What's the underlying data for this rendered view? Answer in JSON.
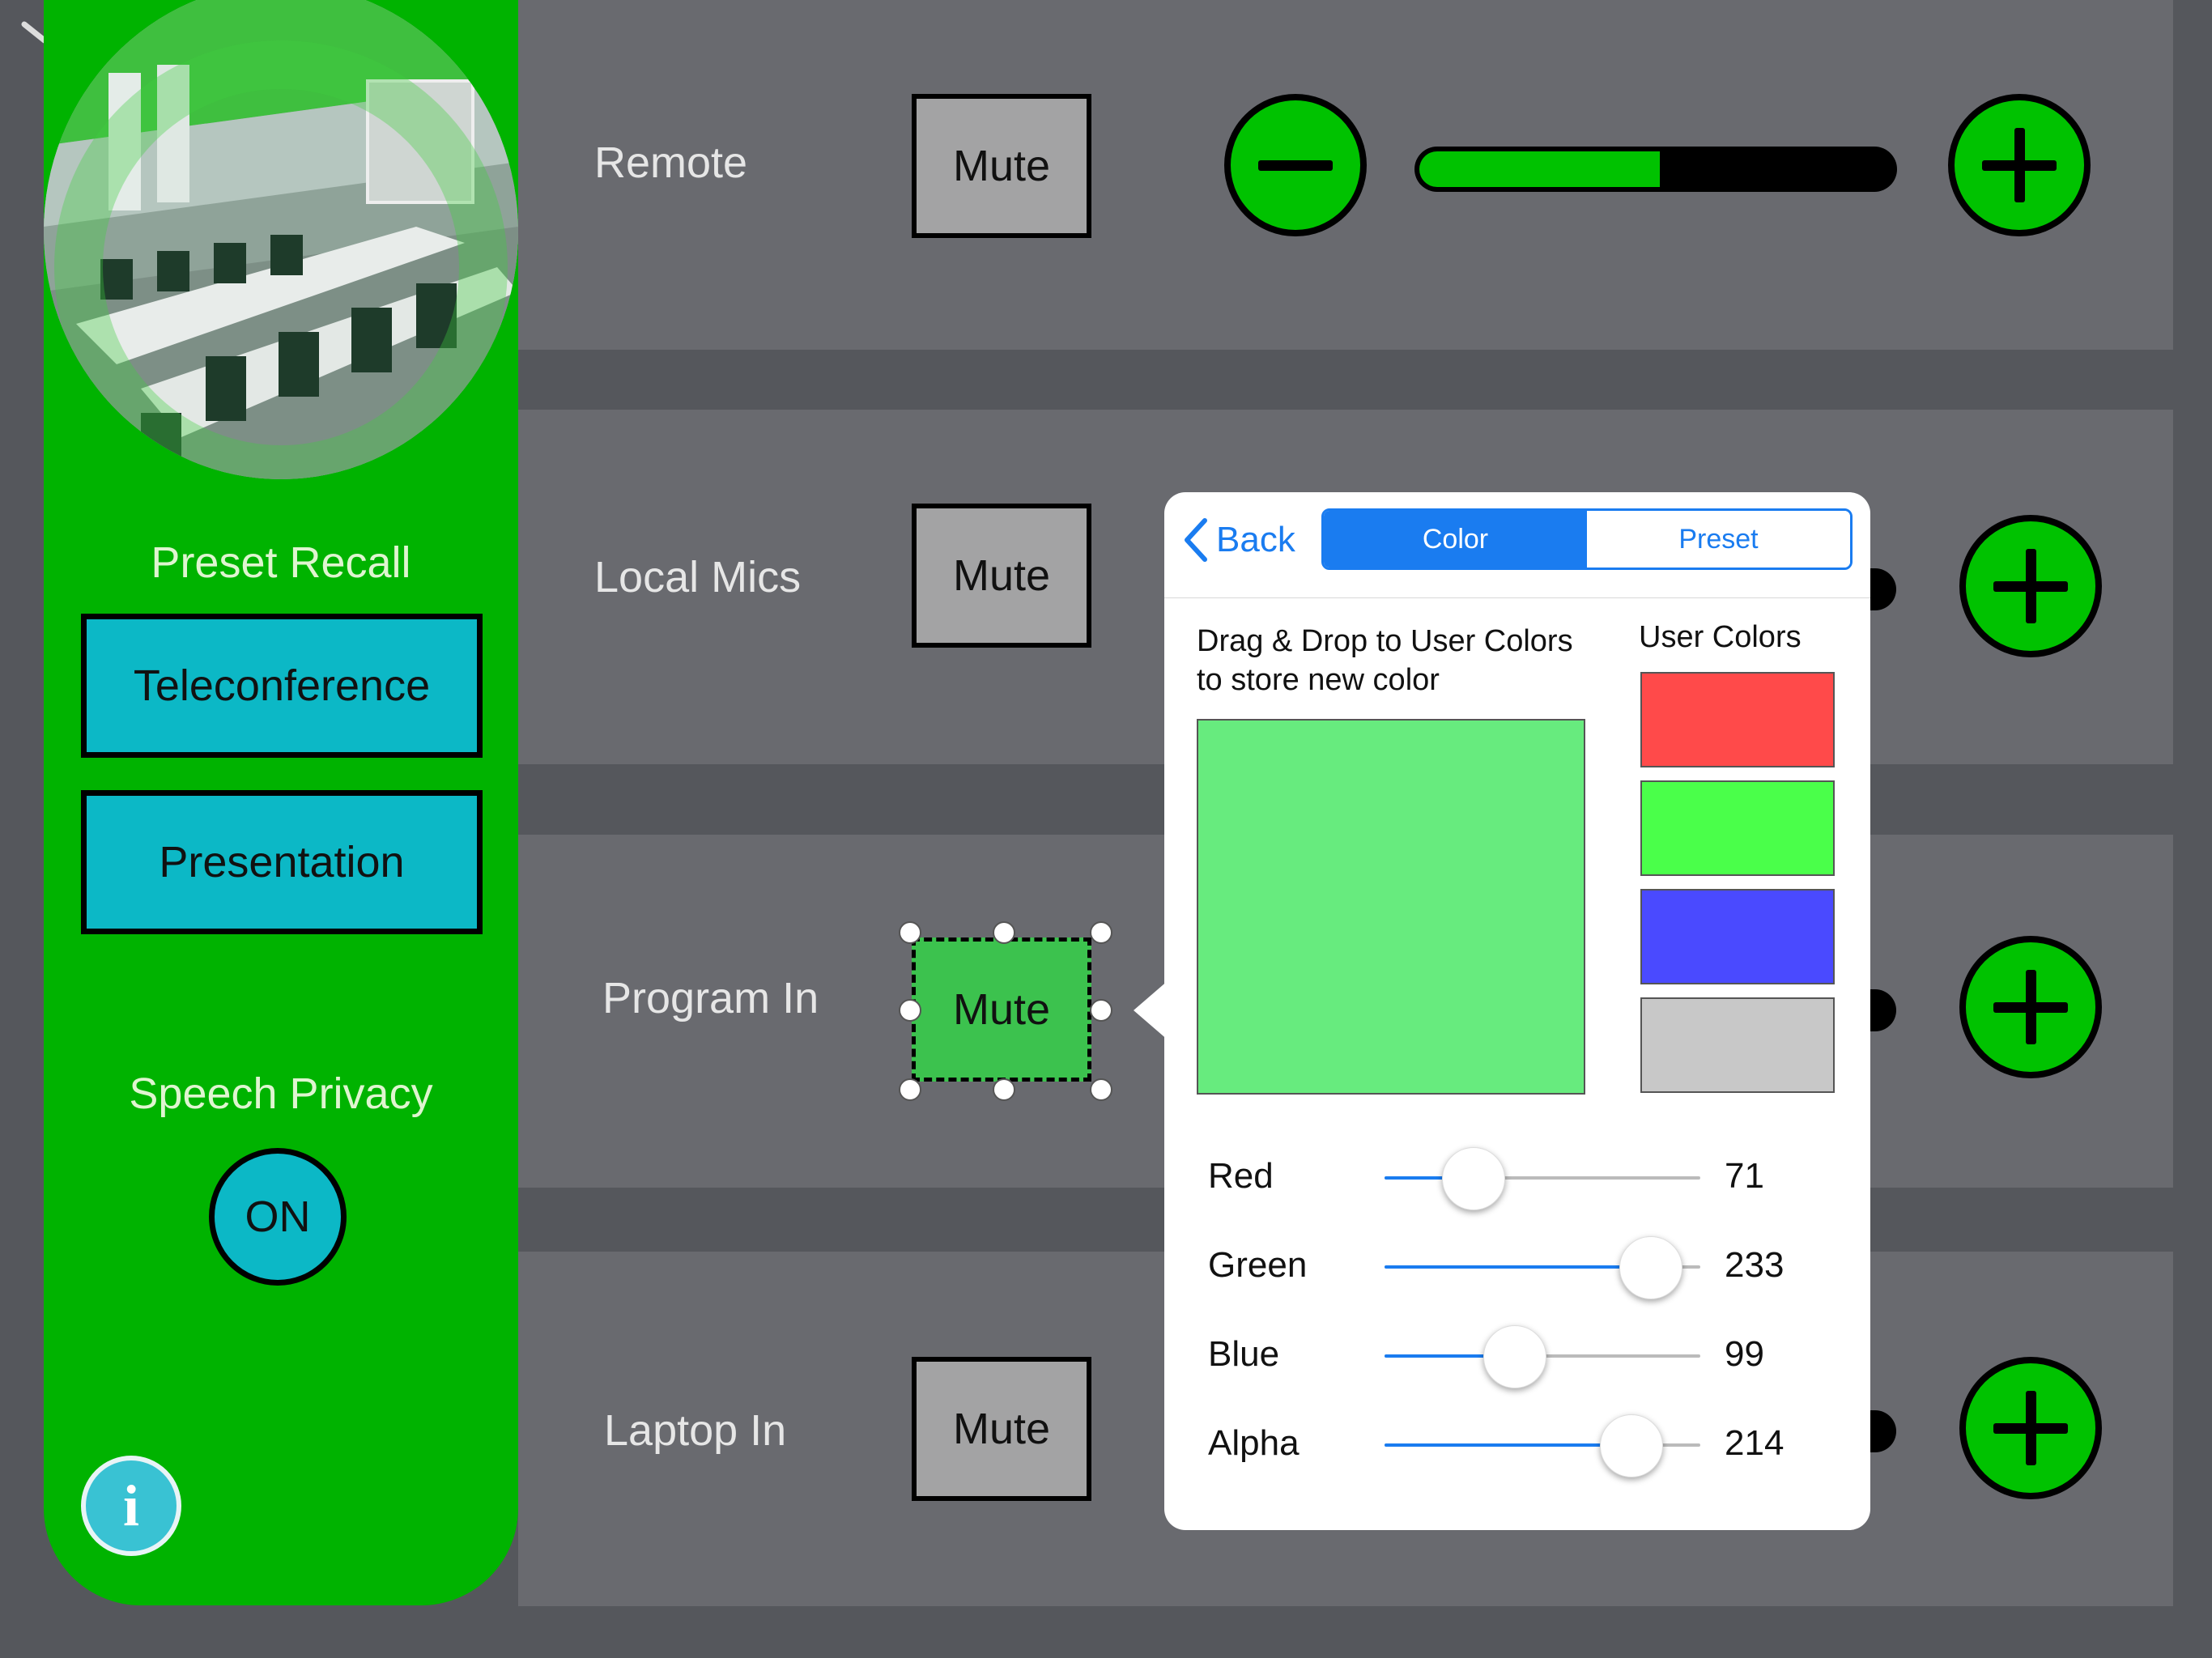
{
  "sidebar": {
    "preset_title": "Preset Recall",
    "presets": [
      {
        "label": "Teleconference"
      },
      {
        "label": "Presentation"
      }
    ],
    "privacy_title": "Speech Privacy",
    "privacy_toggle": "ON",
    "room_photo": "conference-room-image",
    "info_icon": "i"
  },
  "channels": [
    {
      "label": "Remote",
      "mute": "Mute",
      "level": 0.5
    },
    {
      "label": "Local Mics",
      "mute": "Mute"
    },
    {
      "label": "Program In",
      "mute": "Mute"
    },
    {
      "label": "Laptop In",
      "mute": "Mute"
    }
  ],
  "popover": {
    "back": "Back",
    "tabs": [
      "Color",
      "Preset"
    ],
    "active_tab": "Color",
    "hint": [
      "Drag & Drop to User Colors",
      "to store new color"
    ],
    "user_colors_title": "User Colors",
    "preview_color": "#67eb7e",
    "user_colors": [
      "#ff4a4a",
      "#4aff4a",
      "#4a4aff",
      "#c8c8c8"
    ],
    "sliders": [
      {
        "label": "Red",
        "value": "71",
        "fraction": 0.28
      },
      {
        "label": "Green",
        "value": "233",
        "fraction": 0.91
      },
      {
        "label": "Blue",
        "value": "99",
        "fraction": 0.39
      },
      {
        "label": "Alpha",
        "value": "214",
        "fraction": 0.84
      }
    ]
  },
  "colors": {
    "sidebar": "#00b300",
    "preset_button": "#0cb8c6",
    "accent_green": "#00c200",
    "ios_blue": "#1a7cf0",
    "selected_mute": "#3cc24e"
  }
}
